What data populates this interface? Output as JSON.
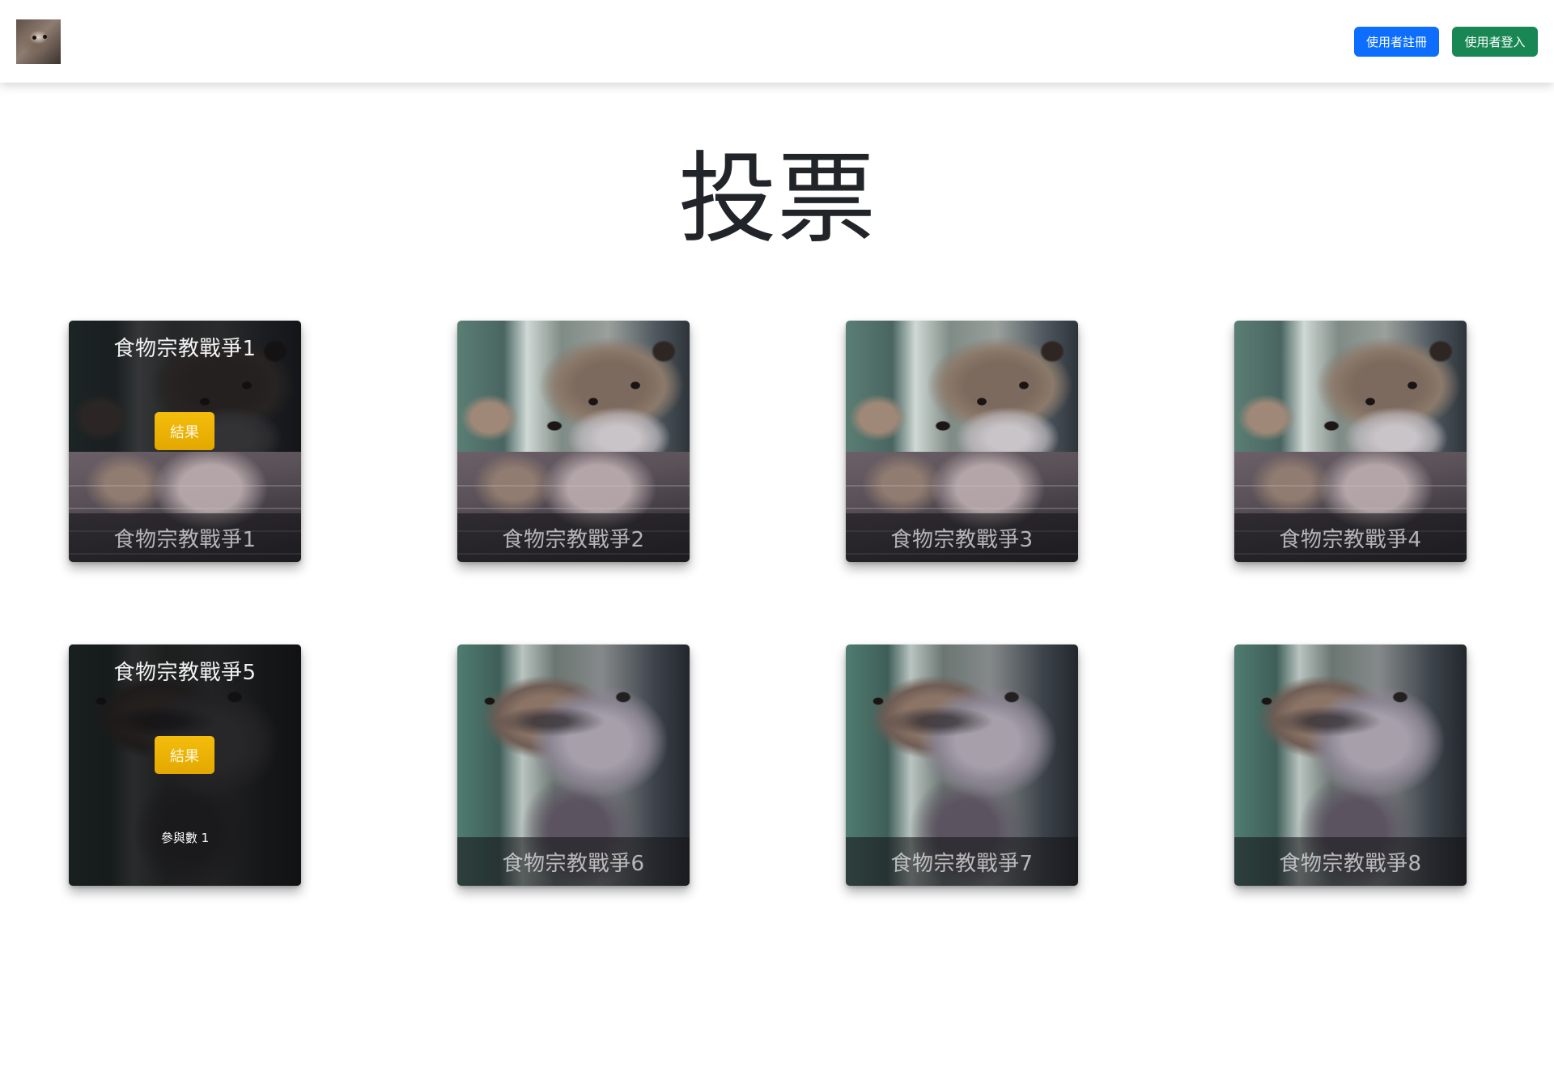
{
  "navbar": {
    "logo_icon": "otter-logo-icon",
    "register_label": "使用者註冊",
    "login_label": "使用者登入",
    "register_color": "#0d6efd",
    "login_color": "#198754"
  },
  "page": {
    "title": "投票"
  },
  "polls": [
    {
      "name": "食物宗教戰爭1",
      "result_label": "結果",
      "participants": ""
    },
    {
      "name": "食物宗教戰爭2"
    },
    {
      "name": "食物宗教戰爭3"
    },
    {
      "name": "食物宗教戰爭4"
    },
    {
      "name": "食物宗教戰爭5",
      "result_label": "結果",
      "participants": "參與數 1"
    },
    {
      "name": "食物宗教戰爭6"
    },
    {
      "name": "食物宗教戰爭7"
    },
    {
      "name": "食物宗教戰爭8"
    }
  ],
  "colors": {
    "result_button": "#f0b400",
    "caption_overlay": "rgba(20,20,24,0.58)"
  }
}
